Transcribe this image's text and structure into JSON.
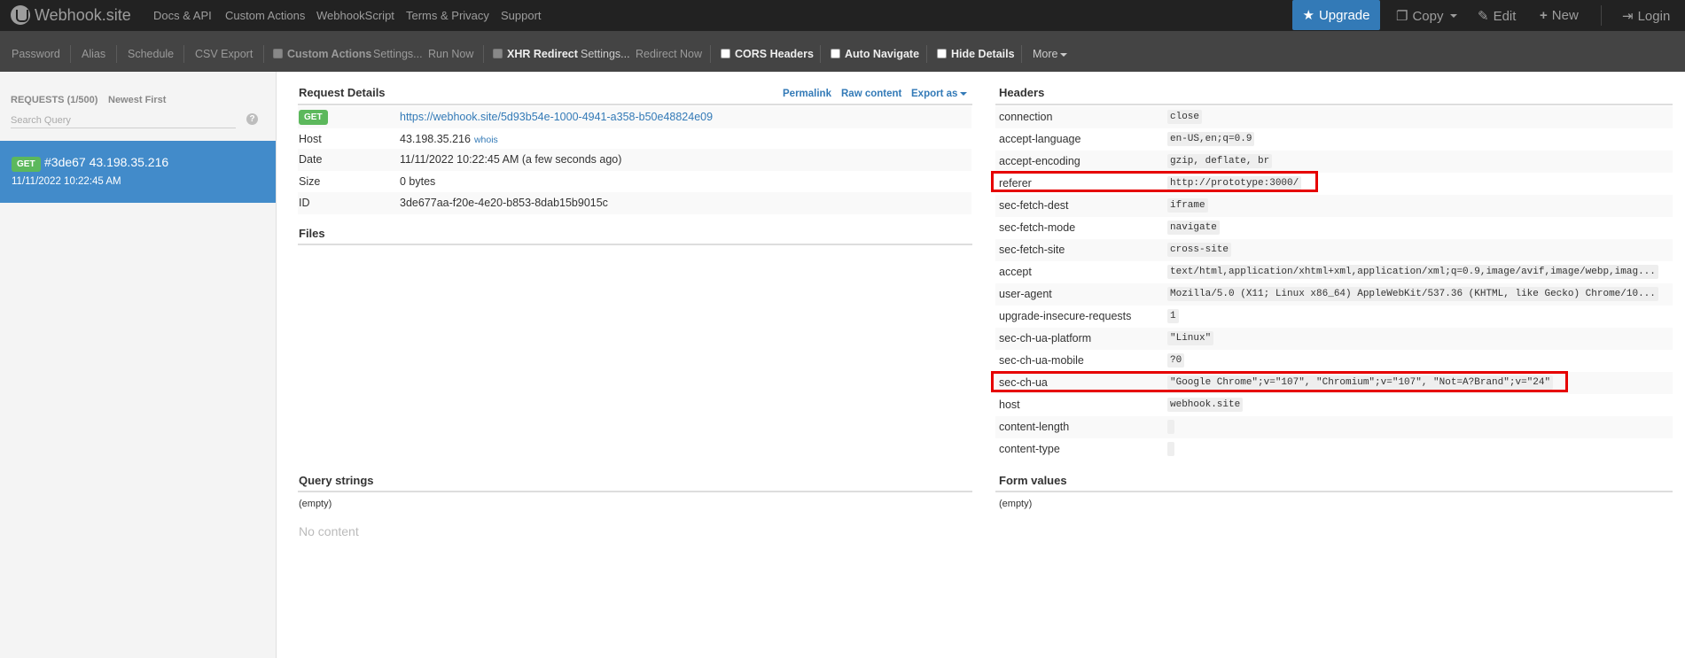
{
  "navbar": {
    "brand": "Webhook.site",
    "links": [
      "Docs & API",
      "Custom Actions",
      "WebhookScript",
      "Terms & Privacy",
      "Support"
    ],
    "upgrade": "Upgrade",
    "copy": "Copy",
    "edit": "Edit",
    "new": "New",
    "login": "Login"
  },
  "toolbar": {
    "password": "Password",
    "alias": "Alias",
    "schedule": "Schedule",
    "csv_export": "CSV Export",
    "custom_actions": "Custom Actions",
    "custom_settings": "Settings...",
    "run_now": "Run Now",
    "xhr_redirect": "XHR Redirect",
    "xhr_settings": "Settings...",
    "redirect_now": "Redirect Now",
    "cors_headers": "CORS Headers",
    "auto_navigate": "Auto Navigate",
    "hide_details": "Hide Details",
    "more": "More"
  },
  "sidebar": {
    "requests_count": "REQUESTS (1/500)",
    "sort": "Newest First",
    "search_placeholder": "Search Query",
    "help": "?",
    "requests": [
      {
        "method": "GET",
        "title": "#3de67 43.198.35.216",
        "time": "11/11/2022 10:22:45 AM"
      }
    ]
  },
  "details": {
    "title": "Request Details",
    "permalink": "Permalink",
    "raw": "Raw content",
    "export": "Export as",
    "method": "GET",
    "url": "https://webhook.site/5d93b54e-1000-4941-a358-b50e48824e09",
    "rows": [
      {
        "key": "Host",
        "value": "43.198.35.216",
        "extra": "whois"
      },
      {
        "key": "Date",
        "value": "11/11/2022 10:22:45 AM (a few seconds ago)"
      },
      {
        "key": "Size",
        "value": "0 bytes"
      },
      {
        "key": "ID",
        "value": "3de677aa-f20e-4e20-b853-8dab15b9015c"
      }
    ]
  },
  "files": {
    "title": "Files"
  },
  "headers": {
    "title": "Headers",
    "rows": [
      {
        "key": "connection",
        "value": "close"
      },
      {
        "key": "accept-language",
        "value": "en-US,en;q=0.9"
      },
      {
        "key": "accept-encoding",
        "value": "gzip, deflate, br"
      },
      {
        "key": "referer",
        "value": "http://prototype:3000/"
      },
      {
        "key": "sec-fetch-dest",
        "value": "iframe"
      },
      {
        "key": "sec-fetch-mode",
        "value": "navigate"
      },
      {
        "key": "sec-fetch-site",
        "value": "cross-site"
      },
      {
        "key": "accept",
        "value": "text/html,application/xhtml+xml,application/xml;q=0.9,image/avif,image/webp,imag..."
      },
      {
        "key": "user-agent",
        "value": "Mozilla/5.0 (X11; Linux x86_64) AppleWebKit/537.36 (KHTML, like Gecko) Chrome/10..."
      },
      {
        "key": "upgrade-insecure-requests",
        "value": "1"
      },
      {
        "key": "sec-ch-ua-platform",
        "value": "\"Linux\""
      },
      {
        "key": "sec-ch-ua-mobile",
        "value": "?0"
      },
      {
        "key": "sec-ch-ua",
        "value": "\"Google Chrome\";v=\"107\", \"Chromium\";v=\"107\", \"Not=A?Brand\";v=\"24\""
      },
      {
        "key": "host",
        "value": "webhook.site"
      },
      {
        "key": "content-length",
        "value": ""
      },
      {
        "key": "content-type",
        "value": ""
      }
    ]
  },
  "query": {
    "title": "Query strings",
    "empty": "(empty)"
  },
  "form": {
    "title": "Form values",
    "empty": "(empty)"
  },
  "body": {
    "no_content": "No content"
  },
  "colors": {
    "navbar": "#222222",
    "toolbar": "#444444",
    "accent": "#337ab7",
    "selected": "#428bca",
    "get_badge": "#5cb85c",
    "highlight": "#e60000"
  }
}
